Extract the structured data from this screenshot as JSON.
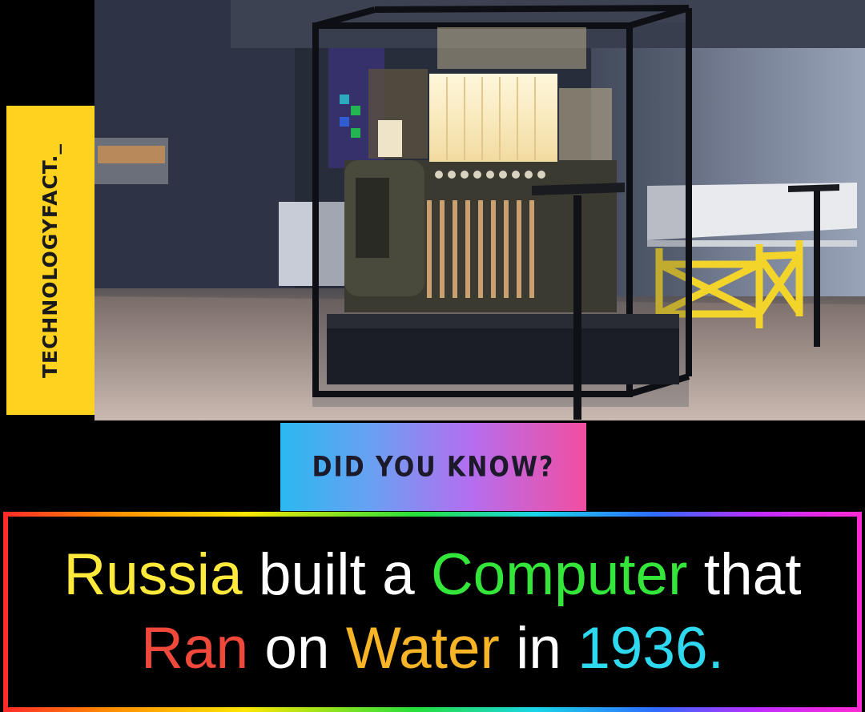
{
  "brand": {
    "handle": "TECHNOLOGYFACT._"
  },
  "badge": {
    "text": "DID YOU KNOW?"
  },
  "caption": {
    "line1": [
      {
        "text": "Russia",
        "color": "#ffe93a"
      },
      {
        "text": " built a ",
        "color": "#ffffff"
      },
      {
        "text": "Computer",
        "color": "#34e63a"
      },
      {
        "text": " that",
        "color": "#ffffff"
      }
    ],
    "line2": [
      {
        "text": "Ran",
        "color": "#f0483a"
      },
      {
        "text": " on ",
        "color": "#ffffff"
      },
      {
        "text": "Water",
        "color": "#f6b426"
      },
      {
        "text": " in ",
        "color": "#ffffff"
      },
      {
        "text": "1936.",
        "color": "#2ed8ee"
      }
    ]
  },
  "colors": {
    "brand_tab": "#ffd21f",
    "badge_gradient_start": "#2bb8f0",
    "badge_gradient_end": "#f24ea0",
    "background": "#000000"
  }
}
